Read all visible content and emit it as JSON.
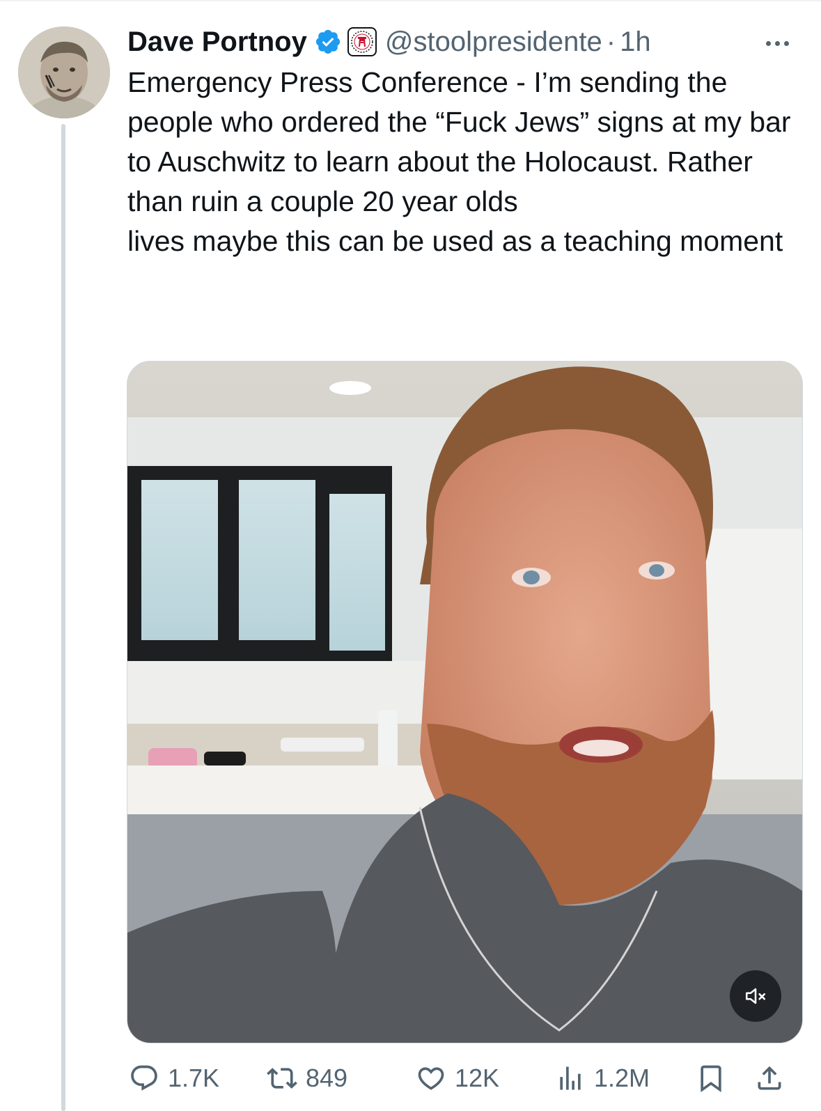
{
  "tweet": {
    "author": {
      "display_name": "Dave Portnoy",
      "handle": "@stoolpresidente",
      "verified": true,
      "affiliate_badge": "barstool-stool-icon"
    },
    "separator": "·",
    "timestamp": "1h",
    "text_lines": [
      "Emergency Press Conference - I’m sending the people who ordered the “Fuck Jews” signs at my bar to Auschwitz to learn about the Holocaust.  Rather than ruin a couple 20 year olds",
      "lives maybe this can be used as a teaching moment"
    ],
    "media": {
      "type": "video",
      "muted": true
    },
    "actions": {
      "replies": "1.7K",
      "reposts": "849",
      "likes": "12K",
      "views": "1.2M"
    }
  },
  "colors": {
    "text_primary": "#0f1419",
    "text_secondary": "#536471",
    "verified_blue": "#1d9bf0",
    "thread_line": "#cfd9de"
  },
  "icons": {
    "more": "more-dots-icon",
    "reply": "reply-bubble-icon",
    "repost": "repost-arrows-icon",
    "like": "heart-icon",
    "views": "bar-chart-icon",
    "bookmark": "bookmark-icon",
    "share": "share-upload-icon",
    "mute": "speaker-muted-icon"
  }
}
